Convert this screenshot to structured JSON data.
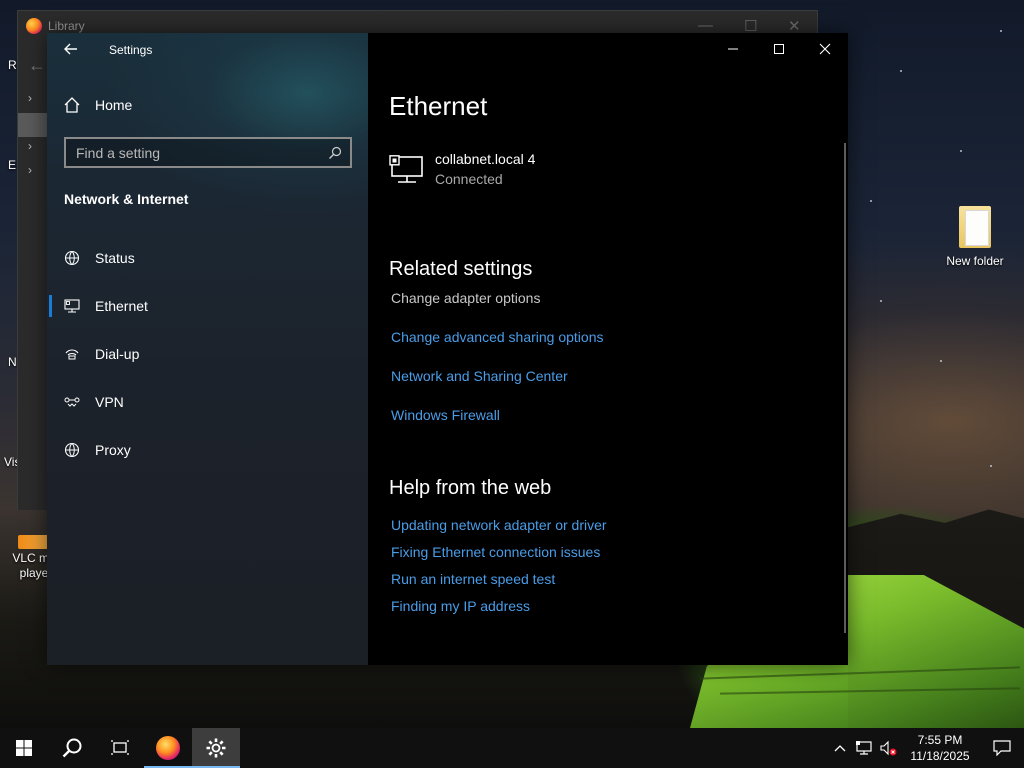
{
  "desktop": {
    "icons": {
      "new_folder": "New folder",
      "vlc_line1": "VLC me",
      "vlc_line2": "playe"
    },
    "left_fragments": [
      "R",
      "E",
      "N",
      "Vis"
    ]
  },
  "library_window": {
    "title": "Library"
  },
  "settings": {
    "nav_title": "Settings",
    "home_label": "Home",
    "search_placeholder": "Find a setting",
    "section_heading": "Network & Internet",
    "nav_items": [
      {
        "label": "Status",
        "icon": "globe-status-icon"
      },
      {
        "label": "Ethernet",
        "icon": "ethernet-icon",
        "active": true
      },
      {
        "label": "Dial-up",
        "icon": "dialup-icon"
      },
      {
        "label": "VPN",
        "icon": "vpn-icon"
      },
      {
        "label": "Proxy",
        "icon": "globe-icon"
      }
    ],
    "page_title": "Ethernet",
    "connection": {
      "name": "collabnet.local 4",
      "status": "Connected"
    },
    "related_settings": {
      "heading": "Related settings",
      "plain_item": "Change adapter options",
      "links": [
        "Change advanced sharing options",
        "Network and Sharing Center",
        "Windows Firewall"
      ]
    },
    "help_web": {
      "heading": "Help from the web",
      "links": [
        "Updating network adapter or driver",
        "Fixing Ethernet connection issues",
        "Run an internet speed test",
        "Finding my IP address"
      ]
    },
    "accent_color": "#1a7ad4",
    "link_color": "#4a9de8"
  },
  "taskbar": {
    "time": "7:55 PM",
    "date": "11/18/2025"
  }
}
